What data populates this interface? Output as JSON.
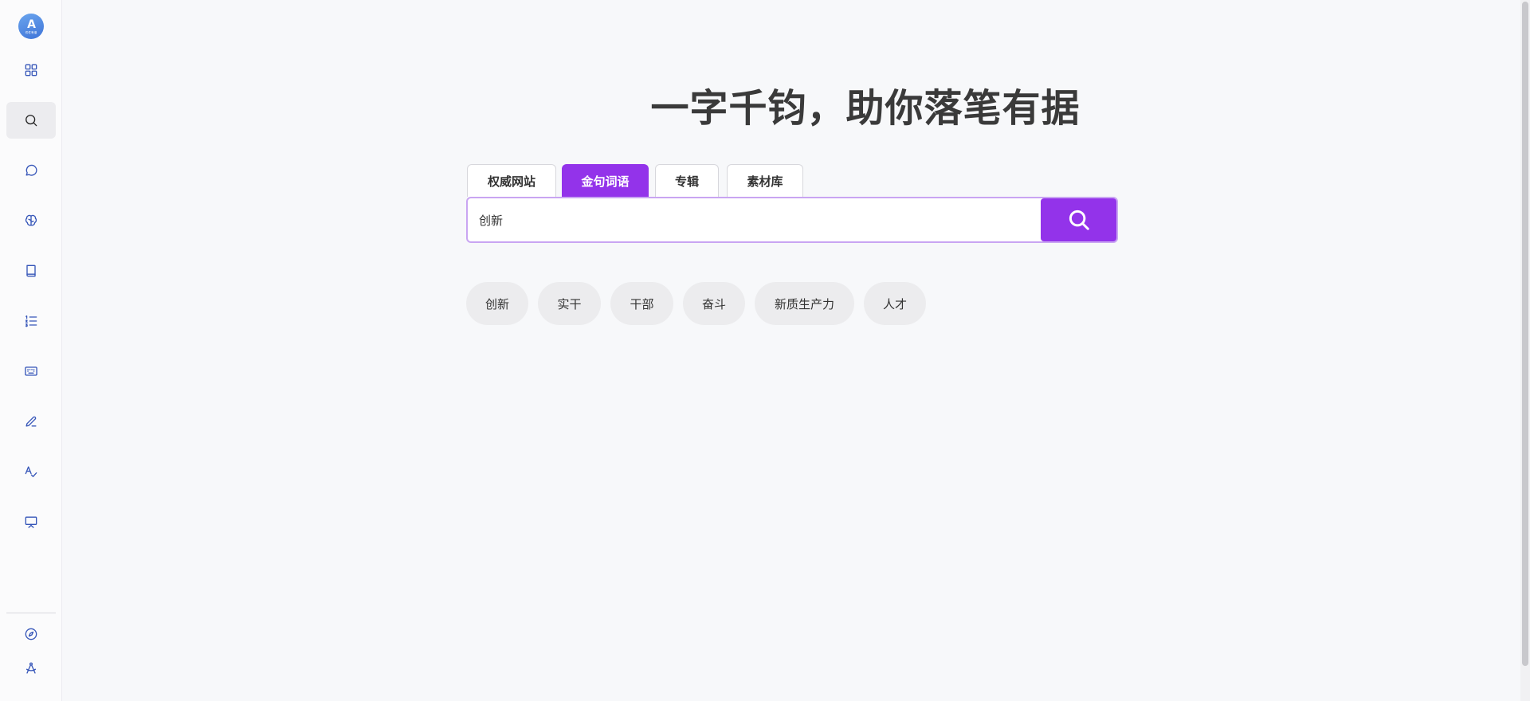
{
  "logo": {
    "mark": "A",
    "text": "件件有谱"
  },
  "sidebar": {
    "items": [
      {
        "icon": "grid-icon"
      },
      {
        "icon": "search-icon",
        "active": true
      },
      {
        "icon": "chat-bubble-icon"
      },
      {
        "icon": "brain-icon"
      },
      {
        "icon": "book-icon"
      },
      {
        "icon": "ordered-list-icon"
      },
      {
        "icon": "keyboard-icon"
      },
      {
        "icon": "pen-icon"
      },
      {
        "icon": "spell-check-icon"
      },
      {
        "icon": "presentation-icon"
      }
    ],
    "bottom_items": [
      {
        "icon": "compass-icon"
      },
      {
        "icon": "drafting-compass-icon"
      }
    ]
  },
  "main": {
    "headline": "一字千钧，助你落笔有据",
    "tabs": [
      {
        "label": "权威网站",
        "active": false
      },
      {
        "label": "金句词语",
        "active": true
      },
      {
        "label": "专辑",
        "active": false
      },
      {
        "label": "素材库",
        "active": false
      }
    ],
    "search": {
      "value": "创新",
      "button_icon": "search-icon"
    },
    "suggestions": [
      "创新",
      "实干",
      "干部",
      "奋斗",
      "新质生产力",
      "人才"
    ]
  },
  "colors": {
    "accent": "#9333ea",
    "sidebar_icon": "#3555b8",
    "background": "#f7f8fa"
  }
}
